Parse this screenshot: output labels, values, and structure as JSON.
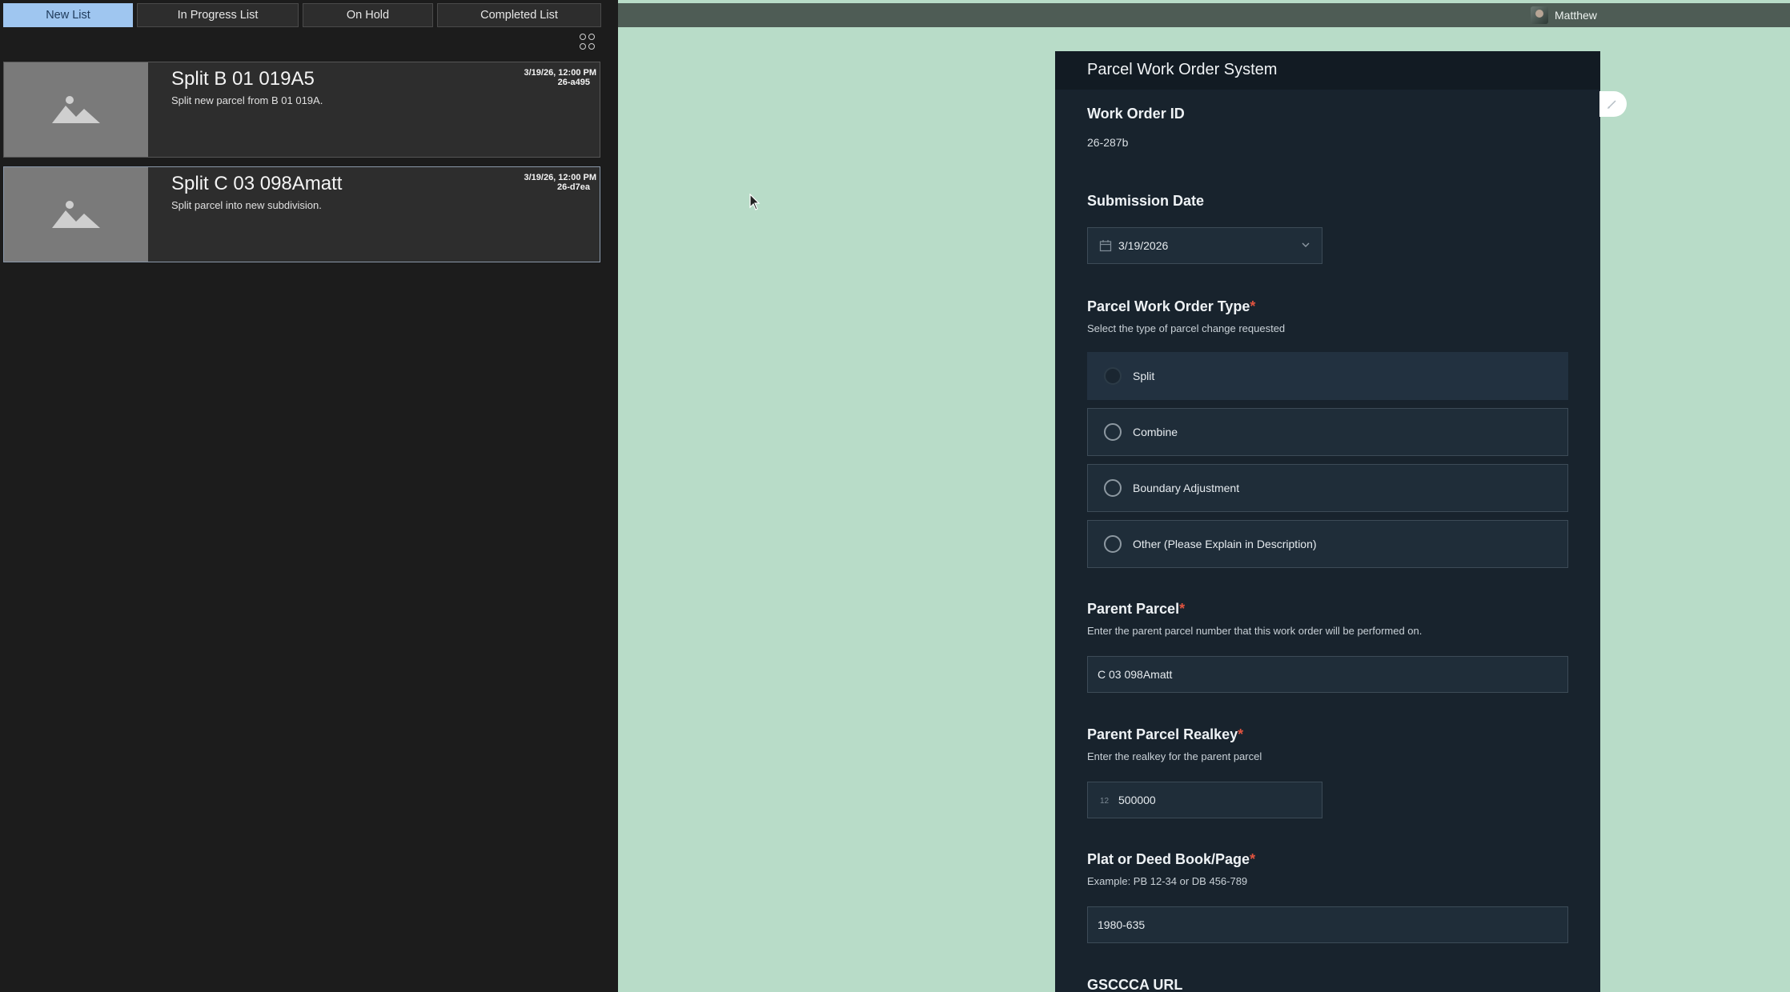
{
  "tabs": {
    "items": [
      {
        "label": "New List",
        "active": true
      },
      {
        "label": "In Progress List",
        "active": false
      },
      {
        "label": "On Hold",
        "active": false
      },
      {
        "label": "Completed List",
        "active": false
      }
    ]
  },
  "list": {
    "view_toggle_icon": "grid-icon",
    "cards": [
      {
        "title": "Split B 01 019A5",
        "description": "Split new parcel from B 01 019A.",
        "date": "3/19/26, 12:00 PM",
        "code": "26-a495",
        "selected": false
      },
      {
        "title": "Split C 03 098Amatt",
        "description": "Split parcel into new subdivision.",
        "date": "3/19/26, 12:00 PM",
        "code": "26-d7ea",
        "selected": true
      }
    ]
  },
  "user": {
    "name": "Matthew"
  },
  "form": {
    "title": "Parcel Work Order System",
    "work_order": {
      "label": "Work Order ID",
      "value": "26-287b"
    },
    "submission_date": {
      "label": "Submission Date",
      "value": "3/19/2026"
    },
    "order_type": {
      "label": "Parcel Work Order Type",
      "hint": "Select the type of parcel change requested",
      "options": [
        "Split",
        "Combine",
        "Boundary Adjustment",
        "Other (Please Explain in Description)"
      ],
      "selected": "Split"
    },
    "parent_parcel": {
      "label": "Parent Parcel",
      "hint": "Enter the parent parcel number that this work order will be performed on.",
      "value": "C 03 098Amatt"
    },
    "realkey": {
      "label": "Parent Parcel Realkey",
      "hint": "Enter the realkey for the parent parcel",
      "value": "500000"
    },
    "book_page": {
      "label": "Plat or Deed Book/Page",
      "hint": "Example: PB 12-34 or DB 456-789",
      "value": "1980-635"
    },
    "gsccca": {
      "label": "GSCCCA URL"
    }
  },
  "colors": {
    "accent_tab": "#9fc6f0",
    "map_background": "#b8dcc8",
    "form_background": "#18232d",
    "required": "#e0533f"
  }
}
